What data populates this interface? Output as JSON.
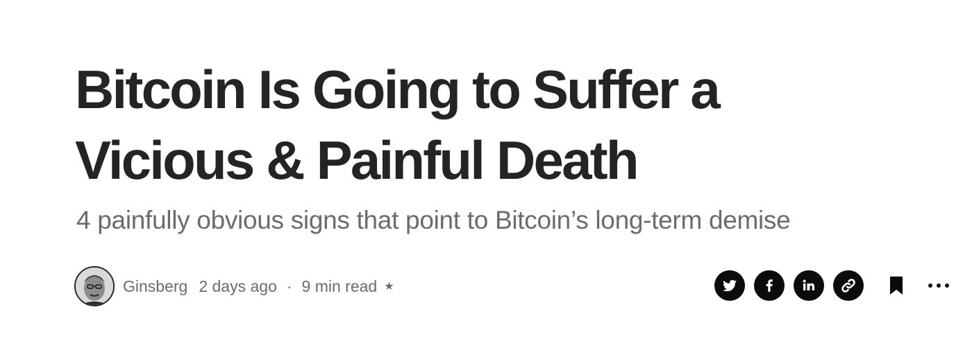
{
  "article": {
    "title": "Bitcoin Is Going to Suffer a Vicious & Painful Death",
    "subtitle": "4 painfully obvious signs that point to Bitcoin’s long-term demise"
  },
  "byline": {
    "author": "Ginsberg",
    "published": "2 days ago",
    "separator": "·",
    "read_time": "9 min read",
    "member_star": "★"
  },
  "share": {
    "icons": [
      "twitter-icon",
      "facebook-icon",
      "linkedin-icon",
      "link-icon"
    ]
  },
  "actions": {
    "bookmark_icon": "bookmark-icon",
    "more_icon": "more-icon"
  },
  "colors": {
    "text": "#242424",
    "muted": "#6b6b6b",
    "icon_fill": "#0b0b0b",
    "background": "#ffffff"
  }
}
